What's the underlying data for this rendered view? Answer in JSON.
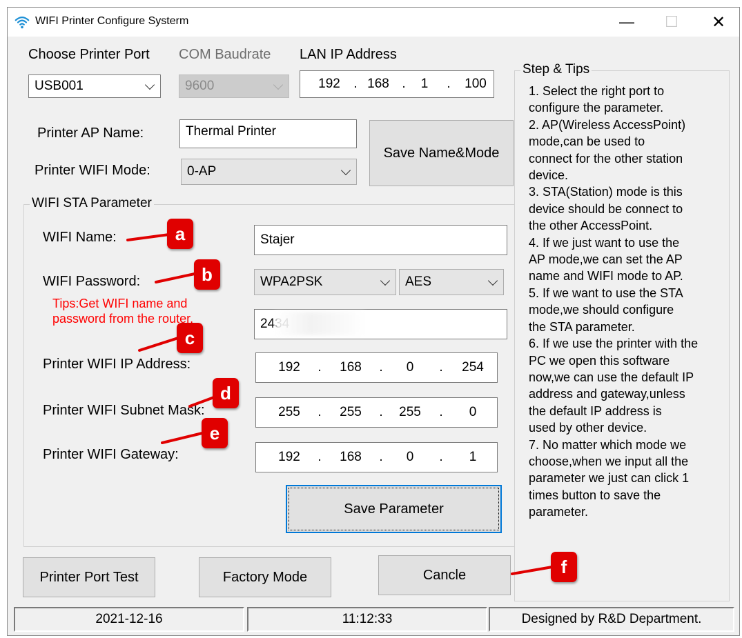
{
  "window": {
    "title": "WIFI Printer Configure Systerm",
    "minimize": "—",
    "maximize": "☐",
    "close": "✕"
  },
  "top": {
    "port_label": "Choose Printer Port",
    "port_value": "USB001",
    "baud_label": "COM Baudrate",
    "baud_value": "9600",
    "lan_label": "LAN IP Address",
    "lan_ip": [
      "192",
      "168",
      "1",
      "100"
    ]
  },
  "ap": {
    "name_label": "Printer AP Name:",
    "name_value": "Thermal Printer",
    "mode_label": "Printer WIFI Mode:",
    "mode_value": "0-AP",
    "save_button": "Save Name&Mode"
  },
  "sta": {
    "group_title": "WIFI STA Parameter",
    "wifi_name_label": "WIFI Name:",
    "wifi_name_value": "Stajer",
    "password_label": "WIFI Password:",
    "auth_value": "WPA2PSK",
    "cipher_value": "AES",
    "tip_line1": "Tips:Get WIFI name and",
    "tip_line2": "password from the router.",
    "password_value": "2434",
    "ip_label": "Printer WIFI IP Address:",
    "ip_value": [
      "192",
      "168",
      "0",
      "254"
    ],
    "mask_label": "Printer WIFI Subnet Mask:",
    "mask_value": [
      "255",
      "255",
      "255",
      "0"
    ],
    "gateway_label": "Printer WIFI Gateway:",
    "gateway_value": [
      "192",
      "168",
      "0",
      "1"
    ],
    "save_button": "Save Parameter"
  },
  "tips": {
    "title": "Step & Tips",
    "lines": [
      "1.  Select the right port to",
      "configure the parameter.",
      "2.  AP(Wireless AccessPoint)",
      "mode,can be used to",
      "connect for the other station",
      "device.",
      "3.  STA(Station) mode is this",
      "device should be connect to",
      "the other AccessPoint.",
      "4.  If we just want to use the",
      "AP mode,we can set the AP",
      "name and WIFI mode to AP.",
      "5.  If we want to use the STA",
      "mode,we should configure",
      "the STA parameter.",
      "6.  If we use the printer with the",
      "PC we open this software",
      "now,we can use the default IP",
      "address and gateway,unless",
      "the default IP address is",
      "used by other device.",
      "7.  No matter which mode we",
      "choose,when we input all the",
      "parameter we just can click 1",
      "times button to save the",
      "parameter."
    ]
  },
  "bottom": {
    "port_test": "Printer Port Test",
    "factory_mode": "Factory Mode",
    "cancel": "Cancle"
  },
  "status": {
    "date": "2021-12-16",
    "time": "11:12:33",
    "designer": "Designed by R&D Department."
  },
  "annotations": [
    "a",
    "b",
    "c",
    "d",
    "e",
    "f"
  ],
  "colors": {
    "annotation_red": "#e00000",
    "tip_red": "#ff0000",
    "focus_blue": "#0078d7",
    "wifi_blue": "#1e90d6"
  }
}
